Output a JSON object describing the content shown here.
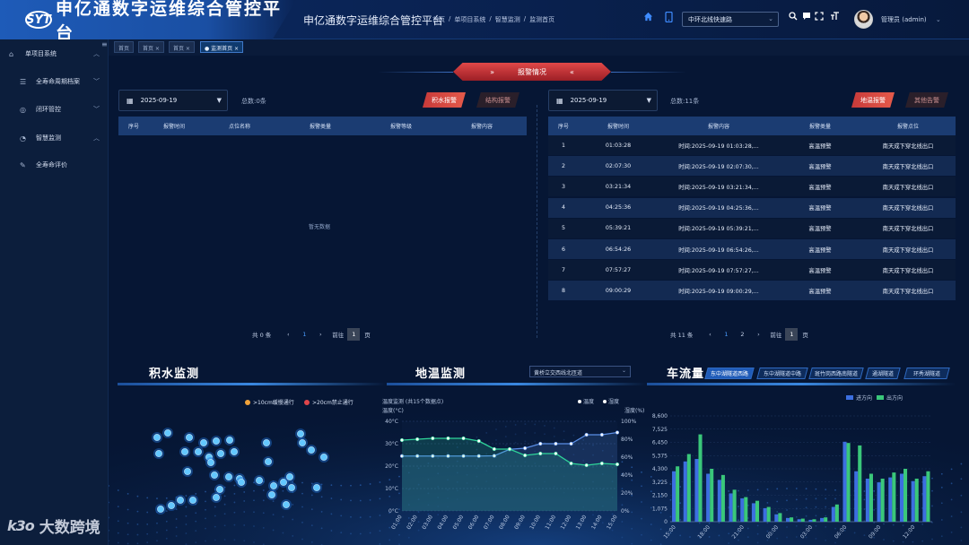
{
  "header": {
    "logo_badge": "SYT",
    "logo_text": "申亿通数字运维综合管控平台",
    "system_title": "申亿通数字运维综合管控平台",
    "breadcrumb": [
      "首页",
      "/",
      "单项目系统",
      "/",
      "智慧监测",
      "/",
      "监测首页"
    ],
    "route_select": "中环北线快速路",
    "admin": "管理员 (admin)",
    "icons": [
      "home-icon",
      "mobile-icon",
      "search-icon",
      "message-icon",
      "fullscreen-icon",
      "font-size-icon"
    ]
  },
  "sidebar": {
    "items": [
      {
        "label": "单项目系统",
        "icon": "building-icon",
        "arrow": "^"
      },
      {
        "label": "全寿命周期档案",
        "icon": "list-icon",
        "arrow": "v"
      },
      {
        "label": "闭环管控",
        "icon": "target-icon",
        "arrow": "v"
      },
      {
        "label": "智慧监测",
        "icon": "gauge-icon",
        "arrow": "^"
      },
      {
        "label": "全寿命评价",
        "icon": "edit-icon",
        "arrow": ""
      }
    ]
  },
  "tabs": [
    {
      "label": "首页 ",
      "active": false
    },
    {
      "label": "首页 ×",
      "active": false
    },
    {
      "label": "首页 ×",
      "active": false
    },
    {
      "label": "● 监测首页 ×",
      "active": true
    }
  ],
  "alarm": {
    "banner": "报警情况",
    "banner_left": "»",
    "banner_right": "«",
    "left": {
      "date": "2025-09-19",
      "total": "总数:0条",
      "btn_active": "积水报警",
      "btn_inactive": "结构报警",
      "columns": [
        "序号",
        "报警时间",
        "点位名称",
        "报警类量",
        "报警等级",
        "报警内容"
      ],
      "empty": "暂无数据",
      "pager": {
        "total": "共 0 条",
        "prev": "‹",
        "page": "1",
        "next": "›",
        "goto": "前往",
        "input": "1",
        "unit": "页"
      }
    },
    "right": {
      "date": "2025-09-19",
      "total": "总数:11条",
      "btn_active": "地温报警",
      "btn_inactive": "其他告警",
      "columns": [
        "序号",
        "报警时间",
        "报警内容",
        "报警类量",
        "报警点位"
      ],
      "rows": [
        [
          "1",
          "01:03:28",
          "时间:2025-09-19 01:03:28,...",
          "高温预警",
          "南天成下穿北线出口"
        ],
        [
          "2",
          "02:07:30",
          "时间:2025-09-19 02:07:30,...",
          "高温预警",
          "南天成下穿北线出口"
        ],
        [
          "3",
          "03:21:34",
          "时间:2025-09-19 03:21:34,...",
          "高温预警",
          "南天成下穿北线出口"
        ],
        [
          "4",
          "04:25:36",
          "时间:2025-09-19 04:25:36,...",
          "高温预警",
          "南天成下穿北线出口"
        ],
        [
          "5",
          "05:39:21",
          "时间:2025-09-19 05:39:21,...",
          "高温预警",
          "南天成下穿北线出口"
        ],
        [
          "6",
          "06:54:26",
          "时间:2025-09-19 06:54:26,...",
          "高温预警",
          "南天成下穿北线出口"
        ],
        [
          "7",
          "07:57:27",
          "时间:2025-09-19 07:57:27,...",
          "高温预警",
          "南天成下穿北线出口"
        ],
        [
          "8",
          "09:00:29",
          "时间:2025-09-19 09:00:29,...",
          "高温预警",
          "南天成下穿北线出口"
        ]
      ],
      "pager": {
        "total": "共 11 条",
        "prev": "‹",
        "page1": "1",
        "page2": "2",
        "next": "›",
        "goto": "前往",
        "input": "1",
        "unit": "页"
      }
    }
  },
  "water": {
    "title": "积水监测",
    "legend": [
      {
        "label": ">10cm缓慢通行",
        "color": "#f0a23a"
      },
      {
        "label": ">20cm禁止通行",
        "color": "#e0454a"
      }
    ],
    "point_color": "#63c8ff"
  },
  "ground_temp": {
    "title": "地温监测",
    "select": "黄桥立交西线北匝道"
  },
  "traffic": {
    "title": "车流量",
    "chips": [
      {
        "label": "东中湖隧道西路",
        "active": true
      },
      {
        "label": "东中湖隧道中路",
        "active": false
      },
      {
        "label": "斑竹岗西路南隧道",
        "active": false
      },
      {
        "label": "通湖隧道",
        "active": false
      },
      {
        "label": "环秀湖隧道",
        "active": false
      }
    ]
  },
  "chart_data": [
    {
      "type": "line",
      "title": "温度监测 (共15个数据点)",
      "ylabel": "温度(°C)",
      "ylabel_right": "湿度(%)",
      "x": [
        "01:00",
        "02:00",
        "03:00",
        "04:00",
        "05:00",
        "06:00",
        "07:00",
        "08:00",
        "09:00",
        "10:00",
        "11:00",
        "12:00",
        "13:00",
        "14:00",
        "15:00"
      ],
      "yticks_left": [
        "40°C",
        "30°C",
        "20°C",
        "10°C",
        "0°C"
      ],
      "yticks_right": [
        "100%",
        "80%",
        "60%",
        "40%",
        "20%",
        "0%"
      ],
      "ylim": [
        0,
        40
      ],
      "ylim_right": [
        0,
        100
      ],
      "series": [
        {
          "name": "温度",
          "axis": "left",
          "color": "#5a8ee6",
          "values": [
            24.5,
            24.5,
            24.5,
            24.5,
            24.5,
            24.5,
            24.6,
            27.5,
            28,
            30,
            30,
            30,
            34,
            34,
            35
          ]
        },
        {
          "name": "湿度",
          "axis": "right",
          "color": "#2fd59a",
          "values": [
            79,
            80,
            81,
            81,
            81,
            78,
            69,
            69,
            62,
            64,
            64,
            53,
            51,
            53,
            52
          ]
        }
      ],
      "grid": true,
      "legend": "top-right"
    },
    {
      "type": "bar",
      "title": "",
      "x": [
        "15:00",
        "16:00",
        "17:00",
        "18:00",
        "19:00",
        "20:00",
        "21:00",
        "22:00",
        "23:00",
        "00:00",
        "01:00",
        "02:00",
        "03:00",
        "04:00",
        "05:00",
        "06:00",
        "07:00",
        "08:00",
        "09:00",
        "10:00",
        "11:00",
        "12:00",
        "13:00"
      ],
      "xticks": [
        "15:00",
        "18:00",
        "21:00",
        "00:00",
        "03:00",
        "06:00",
        "09:00",
        "12:00"
      ],
      "yticks": [
        "8,600",
        "7,525",
        "6,450",
        "5,375",
        "4,300",
        "3,225",
        "2,150",
        "1,075",
        "0"
      ],
      "ylim": [
        0,
        8600
      ],
      "series": [
        {
          "name": "进方向",
          "color": "#3c6fe0",
          "values": [
            4100,
            4900,
            5100,
            3900,
            3400,
            2300,
            1900,
            1500,
            1100,
            600,
            300,
            200,
            150,
            300,
            1200,
            6500,
            4100,
            3500,
            3200,
            3600,
            3900,
            3300,
            3700
          ]
        },
        {
          "name": "出方向",
          "color": "#3ac77a",
          "values": [
            4500,
            5500,
            7100,
            4300,
            3800,
            2600,
            2000,
            1700,
            1200,
            700,
            350,
            250,
            200,
            350,
            1400,
            6400,
            6200,
            3900,
            3500,
            4000,
            4300,
            3500,
            4100
          ]
        }
      ],
      "legend": "top-right"
    }
  ],
  "watermark": {
    "mark": "k3o",
    "text": "大数跨境"
  }
}
